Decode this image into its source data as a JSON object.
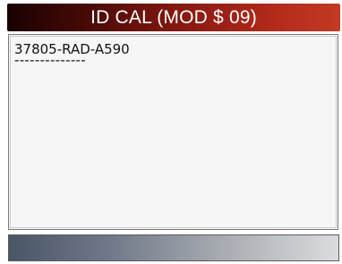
{
  "header": {
    "title": "ID CAL (MOD $ 09)"
  },
  "content": {
    "lines": [
      "37805-RAD-A590",
      "--------------"
    ]
  },
  "colors": {
    "title_bar_start": "#1a0202",
    "title_bar_end": "#c23a22",
    "bottom_bar_start": "#4a5566",
    "bottom_bar_end": "#dadcde"
  }
}
